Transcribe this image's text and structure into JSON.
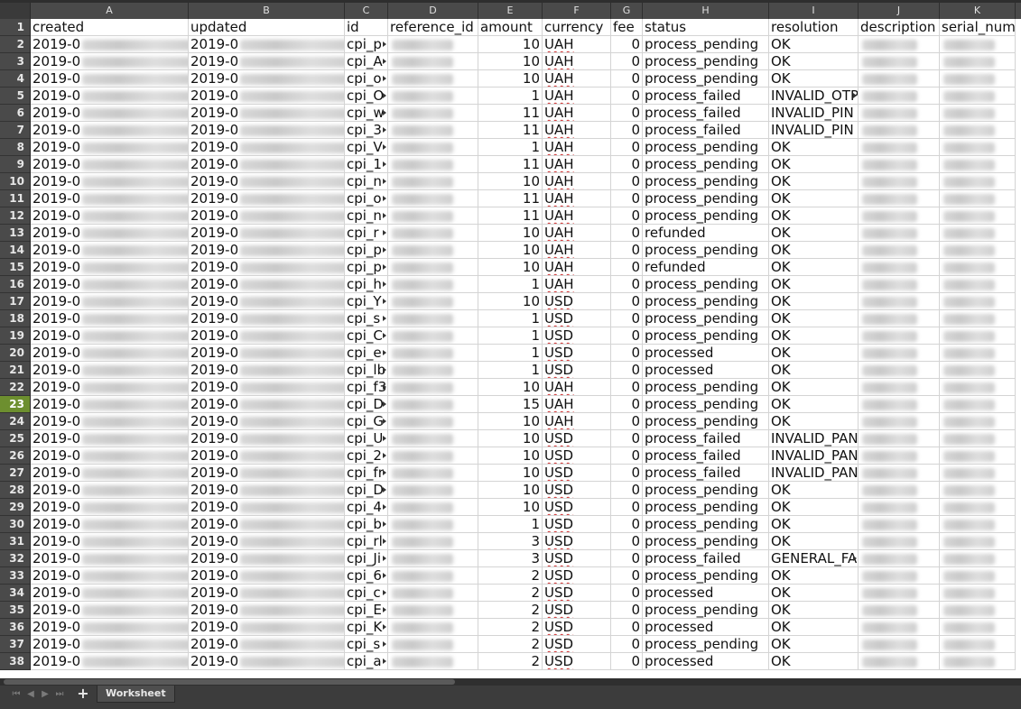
{
  "columns": [
    "A",
    "B",
    "C",
    "D",
    "E",
    "F",
    "G",
    "H",
    "I",
    "J",
    "K"
  ],
  "headers": [
    "created",
    "updated",
    "id",
    "reference_id",
    "amount",
    "currency",
    "fee",
    "status",
    "resolution",
    "description",
    "serial_num"
  ],
  "rows": [
    {
      "n": "2",
      "a": "2019-0",
      "b": "2019-0",
      "c": "cpi_p",
      "e": "10",
      "f": "UAH",
      "g": "0",
      "h": "process_pending",
      "i": "OK"
    },
    {
      "n": "3",
      "a": "2019-0",
      "b": "2019-0",
      "c": "cpi_A",
      "e": "10",
      "f": "UAH",
      "g": "0",
      "h": "process_pending",
      "i": "OK"
    },
    {
      "n": "4",
      "a": "2019-0",
      "b": "2019-0",
      "c": "cpi_o",
      "e": "10",
      "f": "UAH",
      "g": "0",
      "h": "process_pending",
      "i": "OK"
    },
    {
      "n": "5",
      "a": "2019-0",
      "b": "2019-0",
      "c": "cpi_O",
      "e": "1",
      "f": "UAH",
      "g": "0",
      "h": "process_failed",
      "i": "INVALID_OTP"
    },
    {
      "n": "6",
      "a": "2019-0",
      "b": "2019-0",
      "c": "cpi_w",
      "e": "11",
      "f": "UAH",
      "g": "0",
      "h": "process_failed",
      "i": "INVALID_PIN"
    },
    {
      "n": "7",
      "a": "2019-0",
      "b": "2019-0",
      "c": "cpi_3",
      "e": "11",
      "f": "UAH",
      "g": "0",
      "h": "process_failed",
      "i": "INVALID_PIN"
    },
    {
      "n": "8",
      "a": "2019-0",
      "b": "2019-0",
      "c": "cpi_V",
      "e": "1",
      "f": "UAH",
      "g": "0",
      "h": "process_pending",
      "i": "OK"
    },
    {
      "n": "9",
      "a": "2019-0",
      "b": "2019-0",
      "c": "cpi_1",
      "e": "11",
      "f": "UAH",
      "g": "0",
      "h": "process_pending",
      "i": "OK"
    },
    {
      "n": "10",
      "a": "2019-0",
      "b": "2019-0",
      "c": "cpi_n",
      "e": "10",
      "f": "UAH",
      "g": "0",
      "h": "process_pending",
      "i": "OK"
    },
    {
      "n": "11",
      "a": "2019-0",
      "b": "2019-0",
      "c": "cpi_o",
      "e": "11",
      "f": "UAH",
      "g": "0",
      "h": "process_pending",
      "i": "OK"
    },
    {
      "n": "12",
      "a": "2019-0",
      "b": "2019-0",
      "c": "cpi_n",
      "e": "11",
      "f": "UAH",
      "g": "0",
      "h": "process_pending",
      "i": "OK"
    },
    {
      "n": "13",
      "a": "2019-0",
      "b": "2019-0",
      "c": "cpi_r",
      "e": "10",
      "f": "UAH",
      "g": "0",
      "h": "refunded",
      "i": "OK"
    },
    {
      "n": "14",
      "a": "2019-0",
      "b": "2019-0",
      "c": "cpi_p",
      "e": "10",
      "f": "UAH",
      "g": "0",
      "h": "process_pending",
      "i": "OK"
    },
    {
      "n": "15",
      "a": "2019-0",
      "b": "2019-0",
      "c": "cpi_p",
      "e": "10",
      "f": "UAH",
      "g": "0",
      "h": "refunded",
      "i": "OK"
    },
    {
      "n": "16",
      "a": "2019-0",
      "b": "2019-0",
      "c": "cpi_h",
      "e": "1",
      "f": "UAH",
      "g": "0",
      "h": "process_pending",
      "i": "OK"
    },
    {
      "n": "17",
      "a": "2019-0",
      "b": "2019-0",
      "c": "cpi_Y",
      "e": "10",
      "f": "USD",
      "g": "0",
      "h": "process_pending",
      "i": "OK"
    },
    {
      "n": "18",
      "a": "2019-0",
      "b": "2019-0",
      "c": "cpi_s",
      "e": "1",
      "f": "USD",
      "g": "0",
      "h": "process_pending",
      "i": "OK"
    },
    {
      "n": "19",
      "a": "2019-0",
      "b": "2019-0",
      "c": "cpi_C",
      "e": "1",
      "f": "USD",
      "g": "0",
      "h": "process_pending",
      "i": "OK"
    },
    {
      "n": "20",
      "a": "2019-0",
      "b": "2019-0",
      "c": "cpi_e",
      "e": "1",
      "f": "USD",
      "g": "0",
      "h": "processed",
      "i": "OK"
    },
    {
      "n": "21",
      "a": "2019-0",
      "b": "2019-0",
      "c": "cpi_lb",
      "e": "1",
      "f": "USD",
      "g": "0",
      "h": "processed",
      "i": "OK"
    },
    {
      "n": "22",
      "a": "2019-0",
      "b": "2019-0",
      "c": "cpi_f3",
      "e": "10",
      "f": "UAH",
      "g": "0",
      "h": "process_pending",
      "i": "OK"
    },
    {
      "n": "23",
      "a": "2019-0",
      "b": "2019-0",
      "c": "cpi_D",
      "e": "15",
      "f": "UAH",
      "g": "0",
      "h": "process_pending",
      "i": "OK"
    },
    {
      "n": "24",
      "a": "2019-0",
      "b": "2019-0",
      "c": "cpi_G",
      "e": "10",
      "f": "UAH",
      "g": "0",
      "h": "process_pending",
      "i": "OK"
    },
    {
      "n": "25",
      "a": "2019-0",
      "b": "2019-0",
      "c": "cpi_U",
      "e": "10",
      "f": "USD",
      "g": "0",
      "h": "process_failed",
      "i": "INVALID_PAN"
    },
    {
      "n": "26",
      "a": "2019-0",
      "b": "2019-0",
      "c": "cpi_2",
      "e": "10",
      "f": "USD",
      "g": "0",
      "h": "process_failed",
      "i": "INVALID_PAN"
    },
    {
      "n": "27",
      "a": "2019-0",
      "b": "2019-0",
      "c": "cpi_fr",
      "e": "10",
      "f": "USD",
      "g": "0",
      "h": "process_failed",
      "i": "INVALID_PAN"
    },
    {
      "n": "28",
      "a": "2019-0",
      "b": "2019-0",
      "c": "cpi_D",
      "e": "10",
      "f": "USD",
      "g": "0",
      "h": "process_pending",
      "i": "OK"
    },
    {
      "n": "29",
      "a": "2019-0",
      "b": "2019-0",
      "c": "cpi_4",
      "e": "10",
      "f": "USD",
      "g": "0",
      "h": "process_pending",
      "i": "OK"
    },
    {
      "n": "30",
      "a": "2019-0",
      "b": "2019-0",
      "c": "cpi_b",
      "e": "1",
      "f": "USD",
      "g": "0",
      "h": "process_pending",
      "i": "OK"
    },
    {
      "n": "31",
      "a": "2019-0",
      "b": "2019-0",
      "c": "cpi_rl",
      "e": "3",
      "f": "USD",
      "g": "0",
      "h": "process_pending",
      "i": "OK"
    },
    {
      "n": "32",
      "a": "2019-0",
      "b": "2019-0",
      "c": "cpi_Ji",
      "e": "3",
      "f": "USD",
      "g": "0",
      "h": "process_failed",
      "i": "GENERAL_FA"
    },
    {
      "n": "33",
      "a": "2019-0",
      "b": "2019-0",
      "c": "cpi_6",
      "e": "2",
      "f": "USD",
      "g": "0",
      "h": "process_pending",
      "i": "OK"
    },
    {
      "n": "34",
      "a": "2019-0",
      "b": "2019-0",
      "c": "cpi_c",
      "e": "2",
      "f": "USD",
      "g": "0",
      "h": "processed",
      "i": "OK"
    },
    {
      "n": "35",
      "a": "2019-0",
      "b": "2019-0",
      "c": "cpi_E",
      "e": "2",
      "f": "USD",
      "g": "0",
      "h": "process_pending",
      "i": "OK"
    },
    {
      "n": "36",
      "a": "2019-0",
      "b": "2019-0",
      "c": "cpi_K",
      "e": "2",
      "f": "USD",
      "g": "0",
      "h": "processed",
      "i": "OK"
    },
    {
      "n": "37",
      "a": "2019-0",
      "b": "2019-0",
      "c": "cpi_s",
      "e": "2",
      "f": "USD",
      "g": "0",
      "h": "process_pending",
      "i": "OK"
    },
    {
      "n": "38",
      "a": "2019-0",
      "b": "2019-0",
      "c": "cpi_a",
      "e": "2",
      "f": "USD",
      "g": "0",
      "h": "processed",
      "i": "OK"
    }
  ],
  "active_row": "23",
  "sheet_tabs": [
    "Worksheet"
  ],
  "colors": {
    "active_row_header": "#6d8f2f",
    "header_bg": "#4a4a4a",
    "spell_underline": "#d03030"
  }
}
